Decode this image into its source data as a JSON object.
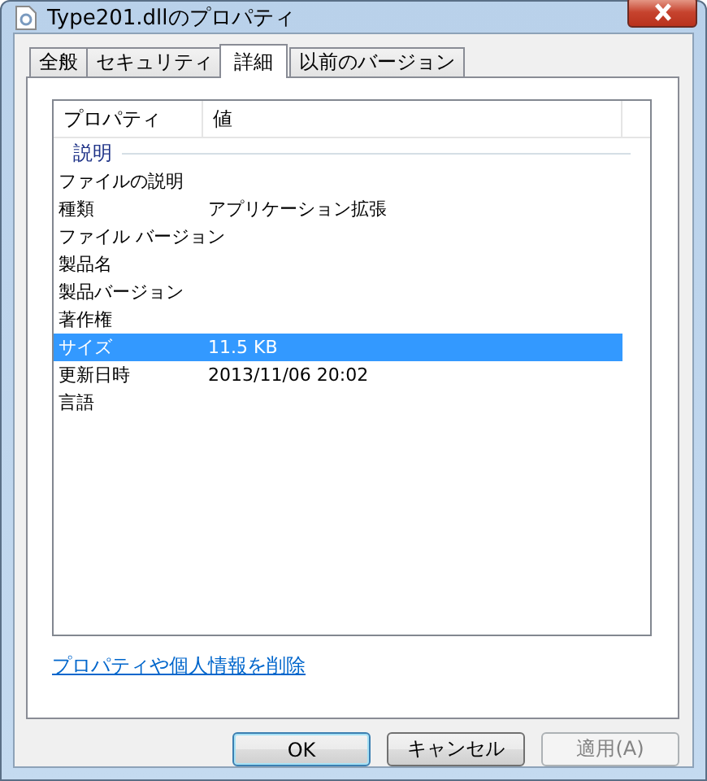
{
  "window": {
    "title": "Type201.dllのプロパティ"
  },
  "tabs": [
    {
      "label": "全般",
      "selected": false
    },
    {
      "label": "セキュリティ",
      "selected": false
    },
    {
      "label": "詳細",
      "selected": true
    },
    {
      "label": "以前のバージョン",
      "selected": false
    }
  ],
  "list": {
    "columns": [
      "プロパティ",
      "値"
    ],
    "groups": [
      {
        "title": "説明",
        "rows": [
          {
            "property": "ファイルの説明",
            "value": "",
            "selected": false
          },
          {
            "property": "種類",
            "value": "アプリケーション拡張",
            "selected": false
          },
          {
            "property": "ファイル バージョン",
            "value": "",
            "selected": false
          },
          {
            "property": "製品名",
            "value": "",
            "selected": false
          },
          {
            "property": "製品バージョン",
            "value": "",
            "selected": false
          },
          {
            "property": "著作権",
            "value": "",
            "selected": false
          },
          {
            "property": "サイズ",
            "value": "11.5 KB",
            "selected": true
          },
          {
            "property": "更新日時",
            "value": "2013/11/06 20:02",
            "selected": false
          },
          {
            "property": "言語",
            "value": "",
            "selected": false
          }
        ]
      }
    ]
  },
  "link": "プロパティや個人情報を削除",
  "buttons": [
    {
      "label": "OK",
      "default": true,
      "disabled": false
    },
    {
      "label": "キャンセル",
      "default": false,
      "disabled": false
    },
    {
      "label": "適用(A)",
      "default": false,
      "disabled": true
    }
  ]
}
